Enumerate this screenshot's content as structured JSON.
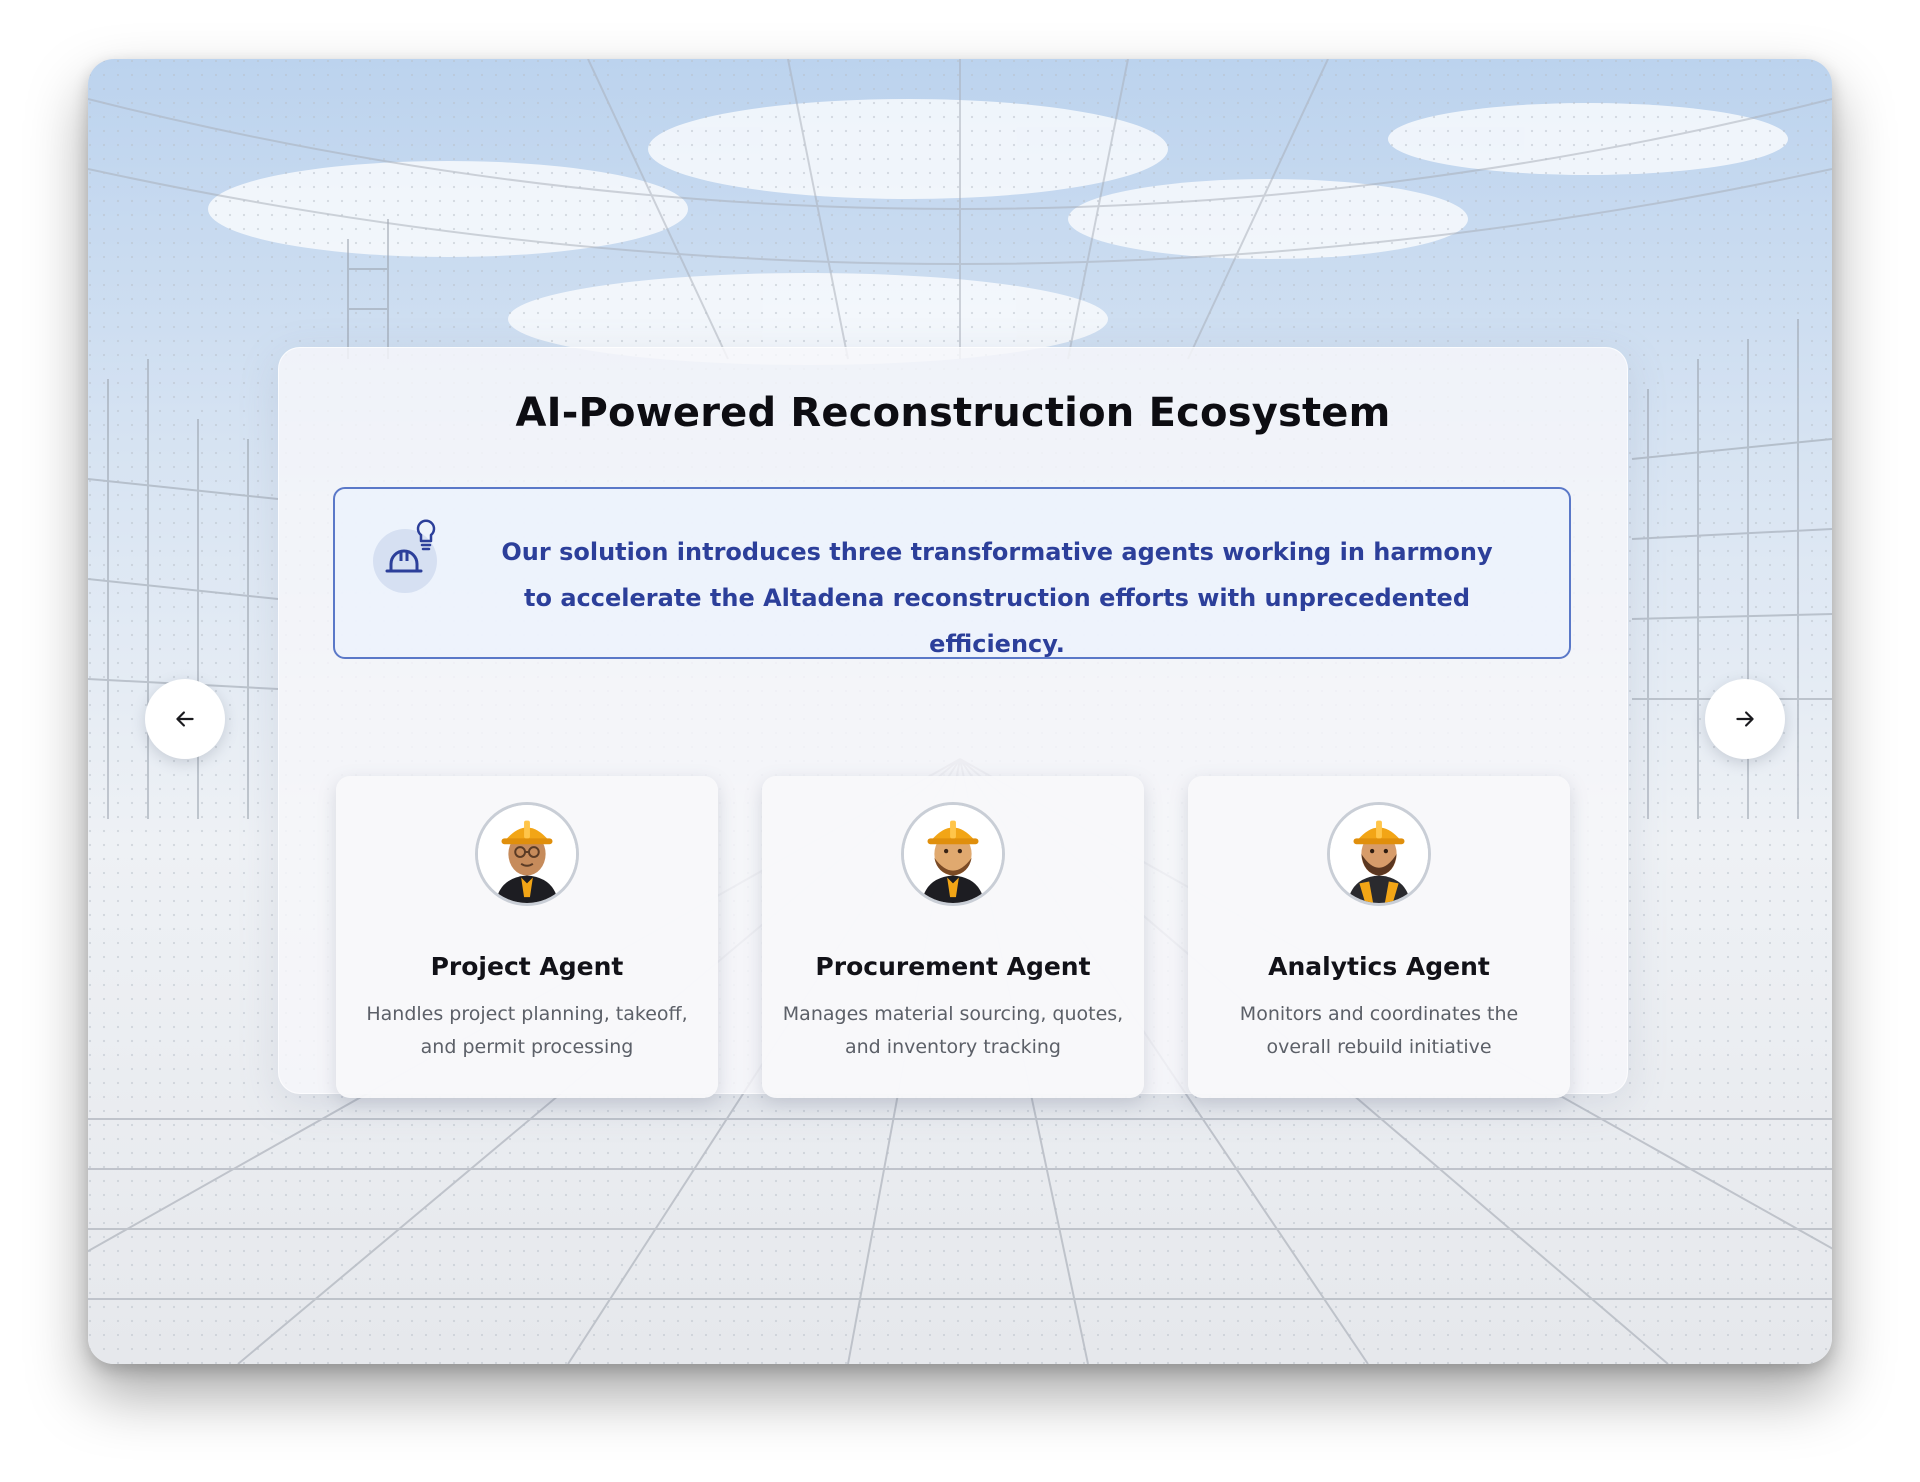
{
  "slide": {
    "title": "AI-Powered Reconstruction Ecosystem",
    "intro_text": "Our solution introduces three transformative agents working in harmony to accelerate the Altadena reconstruction efforts with unprecedented efficiency.",
    "intro_icon": "hardhat-lightbulb-icon"
  },
  "agents": [
    {
      "name": "Project Agent",
      "description": "Handles project planning, takeoff, and permit processing",
      "avatar": "construction-worker-glasses-avatar"
    },
    {
      "name": "Procurement Agent",
      "description": "Manages material sourcing, quotes, and inventory tracking",
      "avatar": "construction-worker-beard-avatar"
    },
    {
      "name": "Analytics Agent",
      "description": "Monitors and coordinates the overall rebuild initiative",
      "avatar": "construction-worker-vest-avatar"
    }
  ],
  "navigation": {
    "prev_icon": "arrow-left-icon",
    "next_icon": "arrow-right-icon"
  },
  "colors": {
    "accent": "#2c3f9a",
    "intro_border": "#5a78c8",
    "helmet": "#f2a516"
  }
}
